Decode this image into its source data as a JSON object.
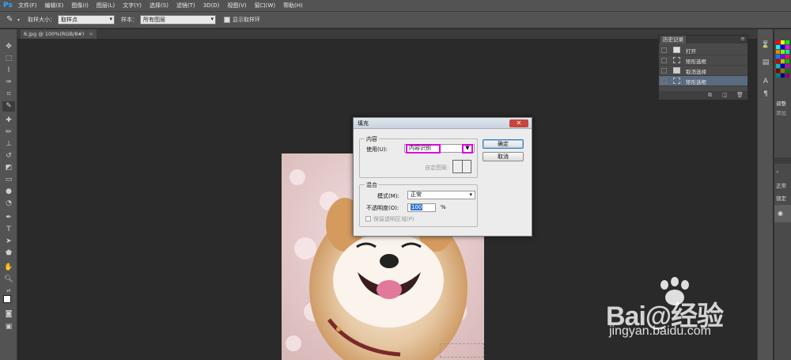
{
  "app": {
    "logo": "Ps"
  },
  "menubar": {
    "items": [
      "文件(F)",
      "编辑(E)",
      "图像(I)",
      "图层(L)",
      "文字(Y)",
      "选择(S)",
      "滤镜(T)",
      "3D(D)",
      "视图(V)",
      "窗口(W)",
      "帮助(H)"
    ]
  },
  "options": {
    "sample_size_label": "取样大小：",
    "sample_size_value": "取样点",
    "sample_label": "样本：",
    "sample_value": "所有图层",
    "show_ring_label": "显示取样环"
  },
  "document": {
    "tab_label": "6.jpg @ 100%(RGB/8#)"
  },
  "dialog": {
    "title": "填充",
    "content_group": "内容",
    "use_label": "使用(U):",
    "use_value": "内容识别",
    "custom_pattern_label": "自定图案:",
    "blend_group": "混合",
    "mode_label": "模式(M):",
    "mode_value": "正常",
    "opacity_label": "不透明度(O):",
    "opacity_value": "100",
    "opacity_unit": "%",
    "preserve_label": "保留透明区域(P)",
    "ok_button": "确定",
    "cancel_button": "取消",
    "close_glyph": "✕"
  },
  "history": {
    "title": "历史记录",
    "items": [
      {
        "label": "打开",
        "selected": false
      },
      {
        "label": "矩形选框",
        "selected": false
      },
      {
        "label": "取消选择",
        "selected": false
      },
      {
        "label": "矩形选框",
        "selected": true
      }
    ]
  },
  "right_dock": {
    "adjust_label": "调整",
    "add_label": "添加",
    "normal_label": "正常",
    "lock_label": "锁定"
  },
  "watermark": {
    "brand": "Bai@经验",
    "url": "jingyan.baidu.com"
  },
  "colors": {
    "highlight": "#e000e0",
    "ok_border": "#3a7cc7",
    "close": "#c6463a"
  },
  "icons": [
    "eyedropper-icon",
    "close-icon",
    "chevron-down-icon",
    "camera-icon",
    "trash-icon",
    "paw-icon"
  ]
}
